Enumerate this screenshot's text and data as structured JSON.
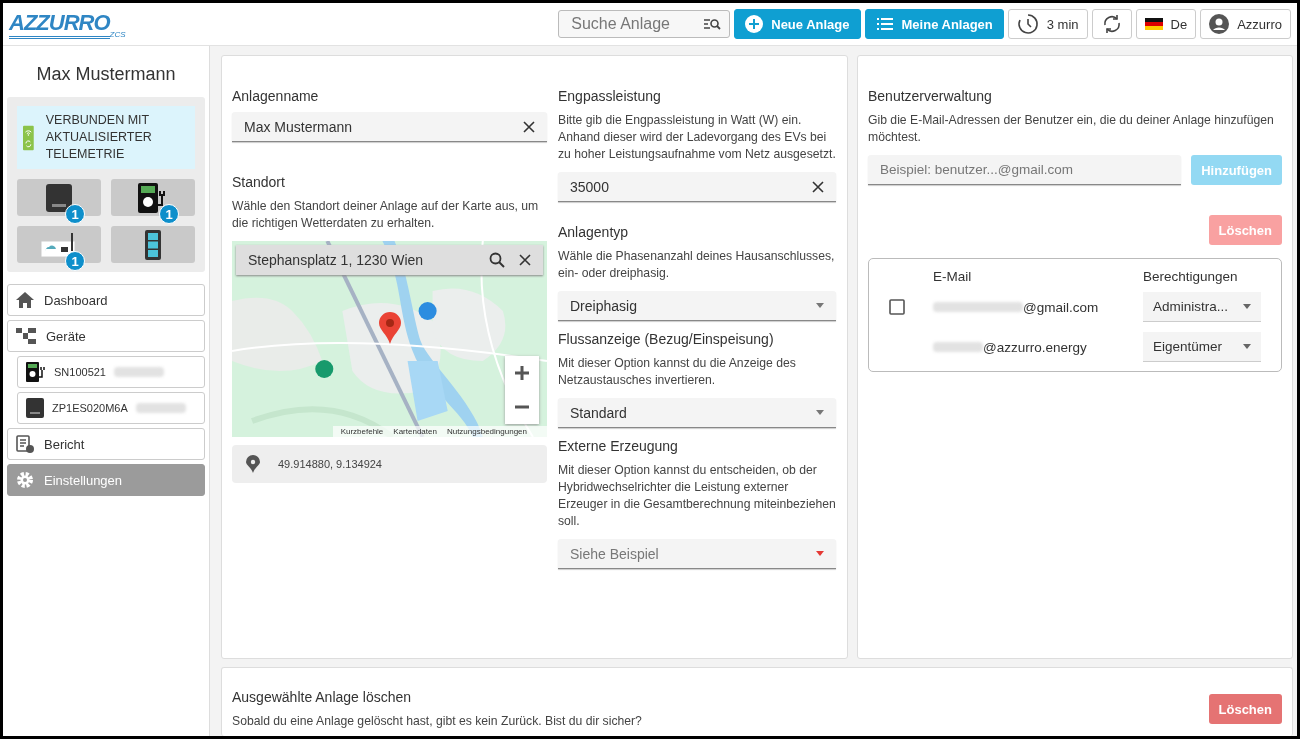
{
  "header": {
    "logo": {
      "name": "AZZURRO",
      "sub": "ZCS"
    },
    "search": {
      "placeholder": "Suche Anlage"
    },
    "buttons": [
      {
        "label": "Neue Anlage",
        "kind": "new"
      },
      {
        "label": "Meine Anlagen",
        "kind": "list"
      }
    ],
    "refresh": "3 min",
    "language": "De",
    "user": "Azzurro"
  },
  "sidebar": {
    "plant_name": "Max Mustermann",
    "status": "VERBUNDEN MIT AKTUALISIERTER TELEMETRIE",
    "devices": [
      {
        "kind": "inverter",
        "badge": "1"
      },
      {
        "kind": "charger",
        "badge": "1"
      },
      {
        "kind": "datalogger",
        "badge": "1"
      },
      {
        "kind": "battery"
      }
    ],
    "nav": [
      {
        "label": "Dashboard",
        "kind": "home",
        "selected": false
      },
      {
        "label": "Geräte",
        "kind": "devices",
        "selected": false,
        "children": [
          {
            "label": "SN100521",
            "kind": "charger",
            "redacted": true
          },
          {
            "label": "ZP1ES020M6A",
            "kind": "inverter",
            "redacted": true
          }
        ]
      },
      {
        "label": "Bericht",
        "kind": "report",
        "selected": false
      },
      {
        "label": "Einstellungen",
        "kind": "settings",
        "selected": true
      }
    ]
  },
  "settings": {
    "name": {
      "title": "Anlagenname",
      "value": "Max Mustermann"
    },
    "location": {
      "title": "Standort",
      "description": "Wähle den Standort deiner Anlage auf der Karte aus, um die richtigen Wetterdaten zu erhalten.",
      "map_search": "Stephansplatz 1, 1230 Wien",
      "attribution": [
        "Kurzbefehle",
        "Kartendaten",
        "Nutzungsbedingungen"
      ],
      "coordinates": "49.914880, 9.134924"
    },
    "sections": [
      {
        "kind": "input",
        "title": "Engpassleistung",
        "description": "Bitte gib die Engpassleistung in Watt (W) ein. Anhand dieser wird der Ladevorgang des EVs bei zu hoher Leistungsaufnahme vom Netz ausgesetzt.",
        "value": "35000"
      },
      {
        "kind": "select",
        "title": "Anlagentyp",
        "description": "Wähle die Phasenanzahl deines Hausanschlusses, ein- oder dreiphasig.",
        "value": "Dreiphasig",
        "error": false
      },
      {
        "kind": "select",
        "title": "Flussanzeige (Bezug/Einspeisung)",
        "description": "Mit dieser Option kannst du die Anzeige des Netzaustausches invertieren.",
        "value": "Standard",
        "error": false
      },
      {
        "kind": "select",
        "title": "Externe Erzeugung",
        "description": "Mit dieser Option kannst du entscheiden, ob der Hybridwechselrichter die Leistung externer Erzeuger in die Gesamtberechnung miteinbeziehen soll.",
        "placeholder": "Siehe Beispiel",
        "error": true
      }
    ]
  },
  "users": {
    "title": "Benutzerverwaltung",
    "description": "Gib die E-Mail-Adressen der Benutzer ein, die du deiner Anlage hinzufügen möchtest.",
    "email": {
      "placeholder": "Beispiel: benutzer...@gmail.com"
    },
    "add_button": {
      "label": "Hinzufügen",
      "disabled": true
    },
    "delete_button": {
      "label": "Löschen",
      "disabled": true
    },
    "columns": [
      "E-Mail",
      "Berechtigungen"
    ],
    "rows": [
      {
        "email": "@gmail.com",
        "redacted": true,
        "selectable": true,
        "checked": false,
        "role": "Administra..."
      },
      {
        "email": "@azzurro.energy",
        "redacted": true,
        "selectable": false,
        "role": "Eigentümer"
      }
    ]
  },
  "delete_plant": {
    "title": "Ausgewählte Anlage löschen",
    "description": "Sobald du eine Anlage gelöscht hast, gibt es kein Zurück. Bist du dir sicher?",
    "button": {
      "label": "Löschen",
      "disabled": false
    }
  }
}
